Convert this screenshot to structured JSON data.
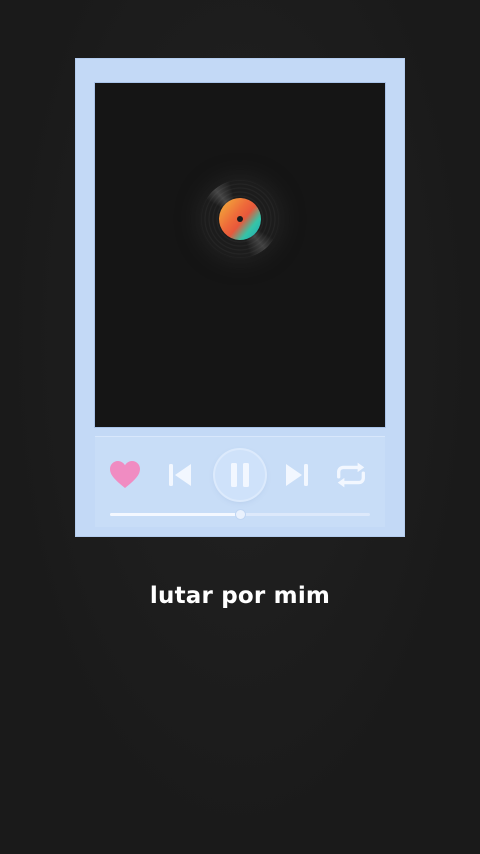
{
  "player": {
    "artwork": {
      "icon": "vinyl-record-icon"
    },
    "controls": {
      "like": {
        "icon": "heart-icon",
        "color": "#f08cc2"
      },
      "previous": {
        "icon": "skip-previous-icon"
      },
      "play_pause": {
        "icon": "pause-icon"
      },
      "next": {
        "icon": "skip-next-icon"
      },
      "repeat": {
        "icon": "repeat-icon"
      }
    },
    "progress_fraction": 0.5
  },
  "song": {
    "title": "lutar por mim"
  },
  "colors": {
    "background": "#1b1b1b",
    "frame": "#c3d9f6",
    "icon": "#f2f7ff",
    "heart": "#f08cc2"
  }
}
